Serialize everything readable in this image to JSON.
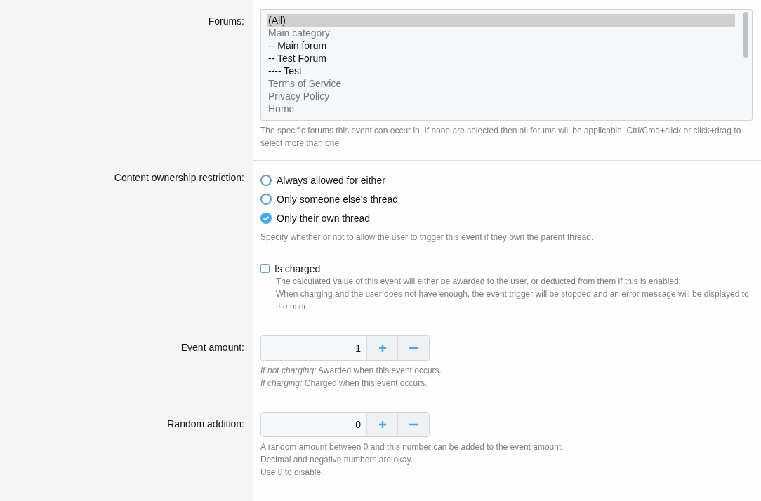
{
  "forums": {
    "label": "Forums:",
    "options": [
      {
        "text": "(All)",
        "kind": "option",
        "selected": true
      },
      {
        "text": "Main category",
        "kind": "category",
        "selected": false
      },
      {
        "text": "-- Main forum",
        "kind": "option",
        "selected": false
      },
      {
        "text": "-- Test Forum",
        "kind": "option",
        "selected": false
      },
      {
        "text": "---- Test",
        "kind": "option",
        "selected": false
      },
      {
        "text": "Terms of Service",
        "kind": "category",
        "selected": false
      },
      {
        "text": "Privacy Policy",
        "kind": "category",
        "selected": false
      },
      {
        "text": "Home",
        "kind": "category",
        "selected": false
      }
    ],
    "hint": "The specific forums this event can occur in. If none are selected then all forums will be applicable. Ctrl/Cmd+click or click+drag to select more than one."
  },
  "ownership": {
    "label": "Content ownership restriction:",
    "options": [
      {
        "label": "Always allowed for either",
        "selected": false
      },
      {
        "label": "Only someone else's thread",
        "selected": false
      },
      {
        "label": "Only their own thread",
        "selected": true
      }
    ],
    "hint": "Specify whether or not to allow the user to trigger this event if they own the parent thread."
  },
  "charged": {
    "label": "Is charged",
    "checked": false,
    "hint_lines": [
      "The calculated value of this event will either be awarded to the user, or deducted from them if this is enabled.",
      "When charging and the user does not have enough, the event trigger will be stopped and an error message will be displayed to the user."
    ]
  },
  "spinners": [
    {
      "label": "Event amount:",
      "value": "1",
      "hint_lines": [
        "*If not charging:* Awarded when this event occurs.",
        "*If charging:* Charged when this event occurs."
      ]
    },
    {
      "label": "Random addition:",
      "value": "0",
      "hint_lines": [
        "A random amount between 0 and this number can be added to the event amount.",
        "Decimal and negative numbers are okay.",
        "Use 0 to disable."
      ]
    }
  ]
}
